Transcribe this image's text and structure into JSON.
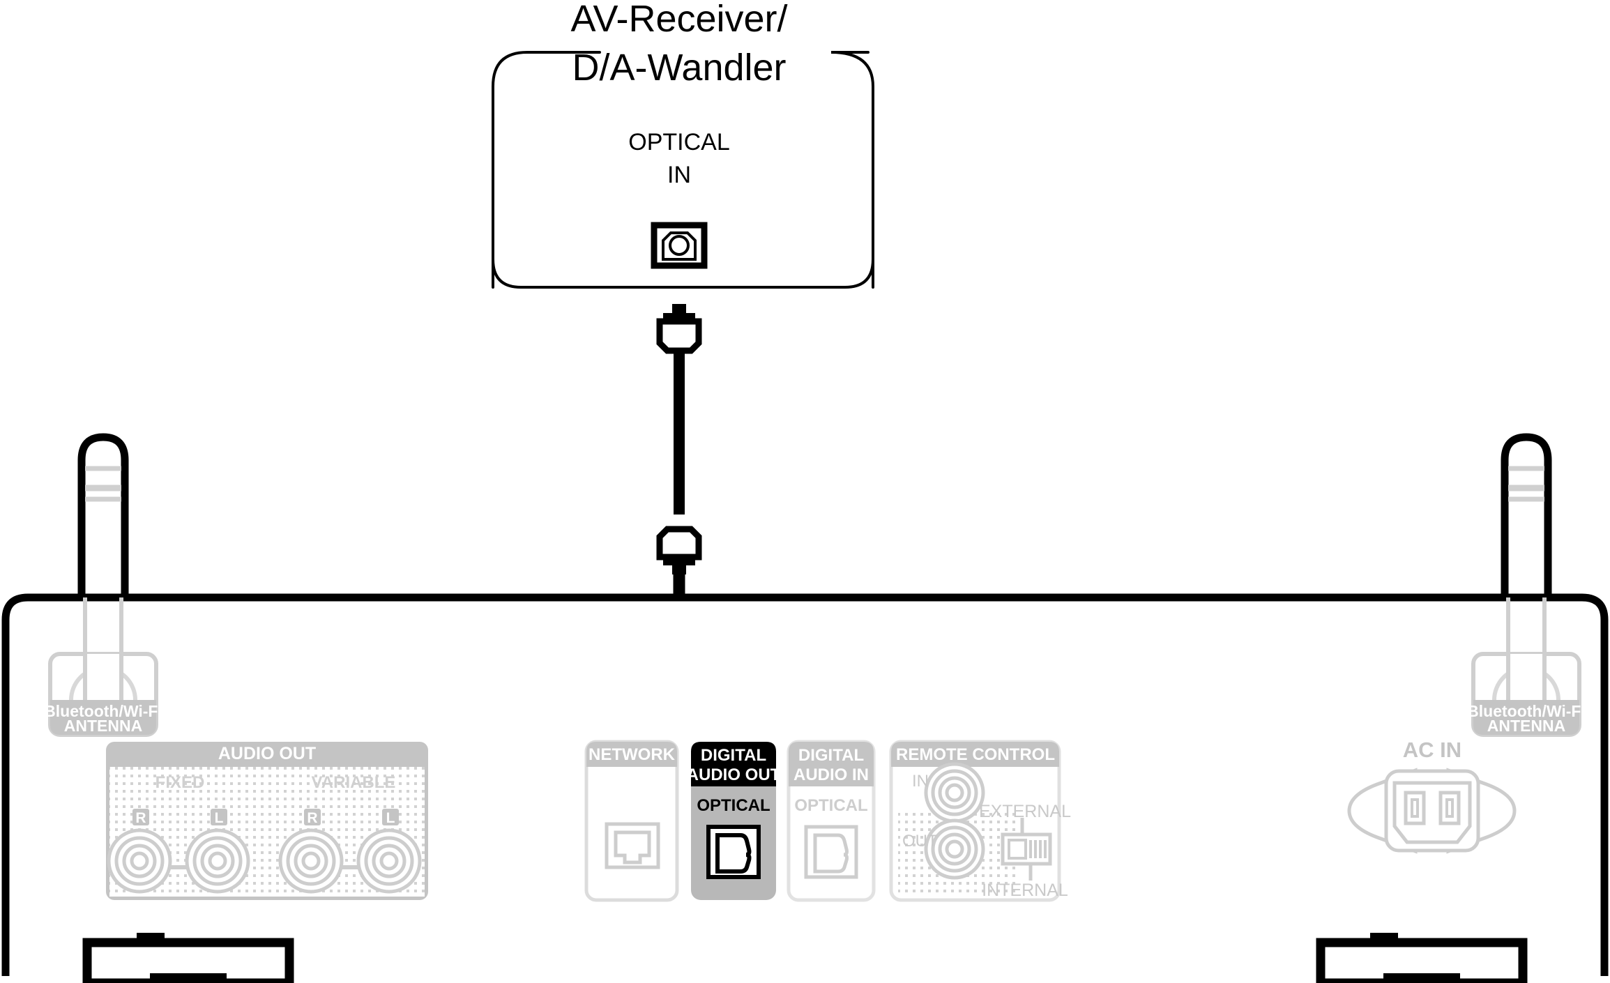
{
  "diagram": {
    "title_line1": "AV-Receiver/",
    "title_line2": "D/A-Wandler",
    "kind": "rear-panel-connection-diagram"
  },
  "external_device": {
    "name": "AV-Receiver/D/A-Wandler",
    "port_group_label_line1": "OPTICAL",
    "port_group_label_line2": "IN",
    "port_icon": "optical-toslink-port-icon"
  },
  "cable": {
    "name": "optical-digital-audio-cable",
    "color": "#000000",
    "connector_top_icon": "optical-cable-connector-icon",
    "connector_bottom_icon": "optical-cable-connector-icon"
  },
  "device": {
    "name": "network-audio-player-rear-panel",
    "antenna_left": {
      "label_line1": "Bluetooth/Wi-Fi",
      "label_line2": "ANTENNA",
      "icon": "antenna-icon"
    },
    "antenna_right": {
      "label_line1": "Bluetooth/Wi-Fi",
      "label_line2": "ANTENNA",
      "icon": "antenna-icon"
    },
    "audio_out": {
      "header": "AUDIO OUT",
      "groups": [
        {
          "label": "FIXED",
          "jacks": [
            {
              "channel": "R"
            },
            {
              "channel": "L"
            }
          ]
        },
        {
          "label": "VARIABLE",
          "jacks": [
            {
              "channel": "R"
            },
            {
              "channel": "L"
            }
          ]
        }
      ]
    },
    "network": {
      "header": "NETWORK",
      "jack_icon": "rj45-ethernet-jack-icon"
    },
    "digital_audio_out": {
      "header_line1": "DIGITAL",
      "header_line2": "AUDIO OUT",
      "sub_label": "OPTICAL",
      "jack_icon": "optical-toslink-jack-icon",
      "highlighted": true,
      "header_bg": "#000000",
      "header_fg": "#ffffff",
      "body_bg": "#b8b8b8",
      "body_fg": "#000000"
    },
    "digital_audio_in": {
      "header_line1": "DIGITAL",
      "header_line2": "AUDIO IN",
      "sub_label": "OPTICAL",
      "jack_icon": "optical-toslink-jack-icon",
      "highlighted": false,
      "header_bg": "#c4c4c4",
      "header_fg": "#ffffff",
      "body_bg": "#ffffff",
      "body_fg": "#cdcdcd"
    },
    "remote_control": {
      "header": "REMOTE CONTROL",
      "jack_in_label": "IN",
      "jack_out_label": "OUT",
      "switch_label_top": "EXTERNAL",
      "switch_label_bottom": "INTERNAL",
      "switch_icon": "toggle-switch-icon"
    },
    "ac_in": {
      "label": "AC IN",
      "icon": "iec-power-inlet-icon"
    }
  },
  "palette": {
    "black": "#000000",
    "panel_gray": "#b8b8b8",
    "label_gray": "#c4c4c4",
    "line_gray": "#cdcdcd",
    "faint_gray": "#d9d9d9",
    "white": "#ffffff"
  }
}
